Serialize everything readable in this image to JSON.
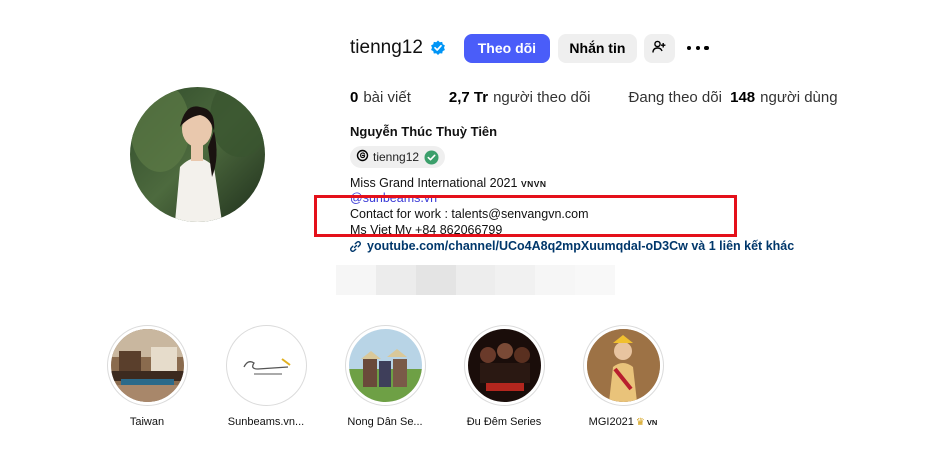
{
  "profile": {
    "username": "tienng12",
    "follow_label": "Theo dõi",
    "message_label": "Nhắn tin",
    "stats": {
      "posts_count": "0",
      "posts_label": "bài viết",
      "followers_count": "2,7 Tr",
      "followers_label": "người theo dõi",
      "following_prefix": "Đang theo dõi",
      "following_count": "148",
      "following_suffix": "người dùng"
    },
    "full_name": "Nguyễn Thúc Thuỳ Tiên",
    "threads_handle": "tienng12",
    "bio": {
      "line1": "Miss Grand International 2021",
      "line1_flag": "VNVN",
      "line2": "@sunbeams.vn",
      "line3": "Contact for work : talents@senvangvn.com",
      "line4": "Ms Viet My +84 862066799"
    },
    "link_text": "youtube.com/channel/UCo4A8q2mpXuumqdaI-oD3Cw và 1 liên kết khác"
  },
  "highlights": [
    {
      "label": "Taiwan"
    },
    {
      "label": "Sunbeams.vn..."
    },
    {
      "label": "Nong Dân Se..."
    },
    {
      "label": "Đu Đêm Series"
    },
    {
      "label": "MGI2021",
      "flag": "VN"
    }
  ],
  "colors": {
    "follow_button": "#4a5df9",
    "secondary_button": "#efefef",
    "verified_badge": "#0095f6",
    "link_text": "#00376b",
    "highlight_box": "#e4101a"
  },
  "icons": {
    "verified": "verified-badge-icon",
    "add_user": "add-user-icon",
    "more": "more-options-icon",
    "threads": "threads-icon",
    "link": "link-chain-icon"
  }
}
